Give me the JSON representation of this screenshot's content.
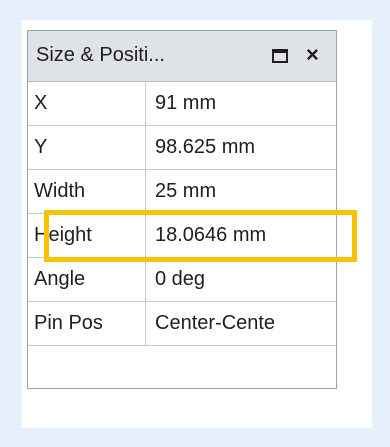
{
  "panel": {
    "title": "Size & Positi...",
    "restore_icon": "restore-window-icon",
    "close_icon": "close-icon",
    "close_glyph": "×"
  },
  "properties": [
    {
      "label": "X",
      "value": "91 mm"
    },
    {
      "label": "Y",
      "value": "98.625 mm"
    },
    {
      "label": "Width",
      "value": "25 mm"
    },
    {
      "label": "Height",
      "value": "18.0646 mm"
    },
    {
      "label": "Angle",
      "value": "0 deg"
    },
    {
      "label": "Pin Pos",
      "value": "Center-Cente"
    }
  ],
  "highlighted_row": "Width",
  "colors": {
    "background": "#e6f1fb",
    "titlebar": "#dfe3e8",
    "highlight": "#f5c300",
    "grid_lines": "#c3c9cf"
  }
}
